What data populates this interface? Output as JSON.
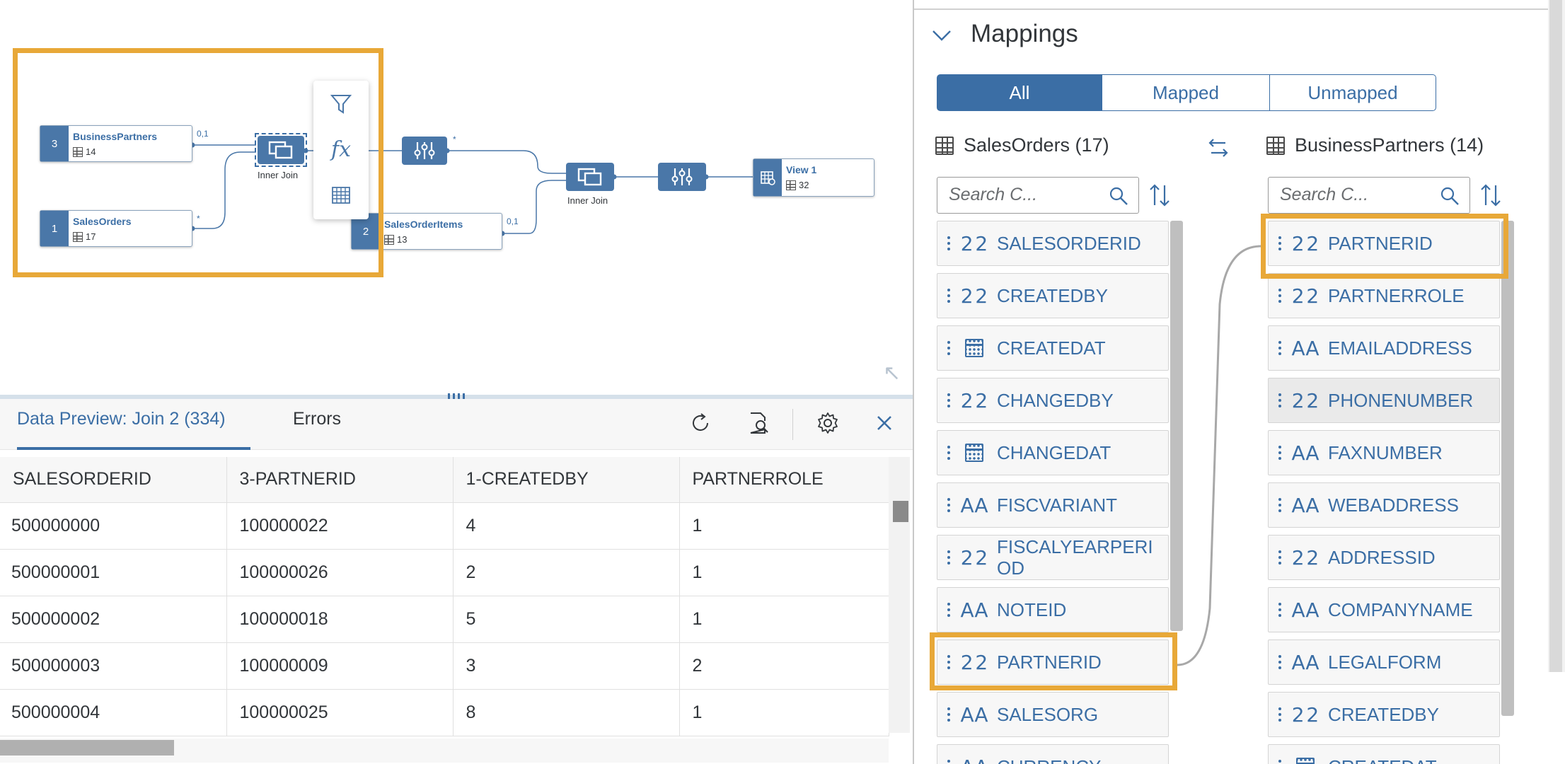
{
  "canvas": {
    "nodes": {
      "business_partners": {
        "index": "3",
        "name": "BusinessPartners",
        "count": "14"
      },
      "sales_orders": {
        "index": "1",
        "name": "SalesOrders",
        "count": "17"
      },
      "sales_order_items": {
        "index": "2",
        "name": "SalesOrderItems",
        "count": "13"
      },
      "view": {
        "name": "View 1",
        "count": "32"
      }
    },
    "join1_label": "Inner Join",
    "join2_label": "Inner Join",
    "link_labels": {
      "bp_join": "0,1",
      "so_join": "*",
      "proj_out": "*",
      "soi_join": "0,1"
    },
    "palette": [
      "filter-icon",
      "function-icon",
      "table-icon"
    ],
    "palette_fx": "fx"
  },
  "preview": {
    "tab_preview": "Data Preview: Join 2 (334)",
    "tab_errors": "Errors",
    "toolbar_icons": [
      "refresh-icon",
      "find-icon",
      "settings-icon",
      "close-icon"
    ],
    "columns": [
      "SALESORDERID",
      "3-PARTNERID",
      "1-CREATEDBY",
      "PARTNERROLE"
    ],
    "rows": [
      [
        "500000000",
        "100000022",
        "4",
        "1"
      ],
      [
        "500000001",
        "100000026",
        "2",
        "1"
      ],
      [
        "500000002",
        "100000018",
        "5",
        "1"
      ],
      [
        "500000003",
        "100000009",
        "3",
        "2"
      ],
      [
        "500000004",
        "100000025",
        "8",
        "1"
      ]
    ]
  },
  "mappings": {
    "title": "Mappings",
    "segments": {
      "all": "All",
      "mapped": "Mapped",
      "unmapped": "Unmapped"
    },
    "source": {
      "title": "SalesOrders (17)",
      "search_placeholder": "Search C...",
      "fields": [
        {
          "type": "2 2",
          "kind": "int",
          "name": "SALESORDERID"
        },
        {
          "type": "2 2",
          "kind": "int",
          "name": "CREATEDBY"
        },
        {
          "type": "",
          "kind": "date",
          "name": "CREATEDAT"
        },
        {
          "type": "2 2",
          "kind": "int",
          "name": "CHANGEDBY"
        },
        {
          "type": "",
          "kind": "date",
          "name": "CHANGEDAT"
        },
        {
          "type": "AA",
          "kind": "str",
          "name": "FISCVARIANT"
        },
        {
          "type": "2 2",
          "kind": "int",
          "name": "FISCALYEARPERI OD"
        },
        {
          "type": "AA",
          "kind": "str",
          "name": "NOTEID"
        },
        {
          "type": "2 2",
          "kind": "int",
          "name": "PARTNERID"
        },
        {
          "type": "AA",
          "kind": "str",
          "name": "SALESORG"
        },
        {
          "type": "AA",
          "kind": "str",
          "name": "CURRENCY"
        }
      ]
    },
    "target": {
      "title": "BusinessPartners (14)",
      "search_placeholder": "Search C...",
      "fields": [
        {
          "type": "2 2",
          "kind": "int",
          "name": "PARTNERID"
        },
        {
          "type": "2 2",
          "kind": "int",
          "name": "PARTNERROLE"
        },
        {
          "type": "AA",
          "kind": "str",
          "name": "EMAILADDRESS"
        },
        {
          "type": "2 2",
          "kind": "int",
          "name": "PHONENUMBER"
        },
        {
          "type": "AA",
          "kind": "str",
          "name": "FAXNUMBER"
        },
        {
          "type": "AA",
          "kind": "str",
          "name": "WEBADDRESS"
        },
        {
          "type": "2 2",
          "kind": "int",
          "name": "ADDRESSID"
        },
        {
          "type": "AA",
          "kind": "str",
          "name": "COMPANYNAME"
        },
        {
          "type": "AA",
          "kind": "str",
          "name": "LEGALFORM"
        },
        {
          "type": "2 2",
          "kind": "int",
          "name": "CREATEDBY"
        },
        {
          "type": "",
          "kind": "date",
          "name": "CREATEDAT"
        }
      ]
    }
  },
  "colors": {
    "accent": "#3b6ea5",
    "node": "#4a77a8",
    "highlight": "#e8a838"
  }
}
